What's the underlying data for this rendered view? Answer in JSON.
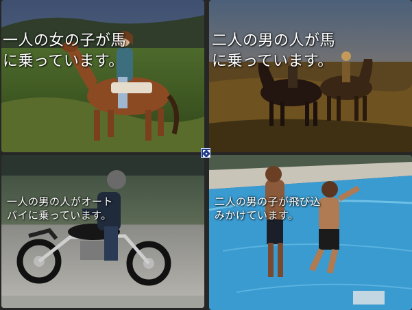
{
  "tiles": [
    {
      "id": "tile-1",
      "scene": "girl-riding-horse",
      "caption_lines": [
        "一人の女の子が馬",
        "に乗っています。"
      ]
    },
    {
      "id": "tile-2",
      "scene": "two-men-riding-horses",
      "caption_lines": [
        "二人の男の人が馬",
        "に乗っています。"
      ]
    },
    {
      "id": "tile-3",
      "scene": "man-riding-motorcycle",
      "caption_lines": [
        "一人の男の人がオート",
        "バイに乗っています。"
      ]
    },
    {
      "id": "tile-4",
      "scene": "boys-jumping-into-pool",
      "caption_lines": [
        "二人の男の子が飛び込",
        "みかけています。"
      ]
    }
  ],
  "center_control": {
    "icon": "expand-arrows-icon"
  },
  "colors": {
    "caption_text": "#ffffff",
    "background": "#262626",
    "pool_water": "#3a9bd0",
    "horse_brown": "#8b4a22",
    "control_blue": "#1e3a8a"
  }
}
